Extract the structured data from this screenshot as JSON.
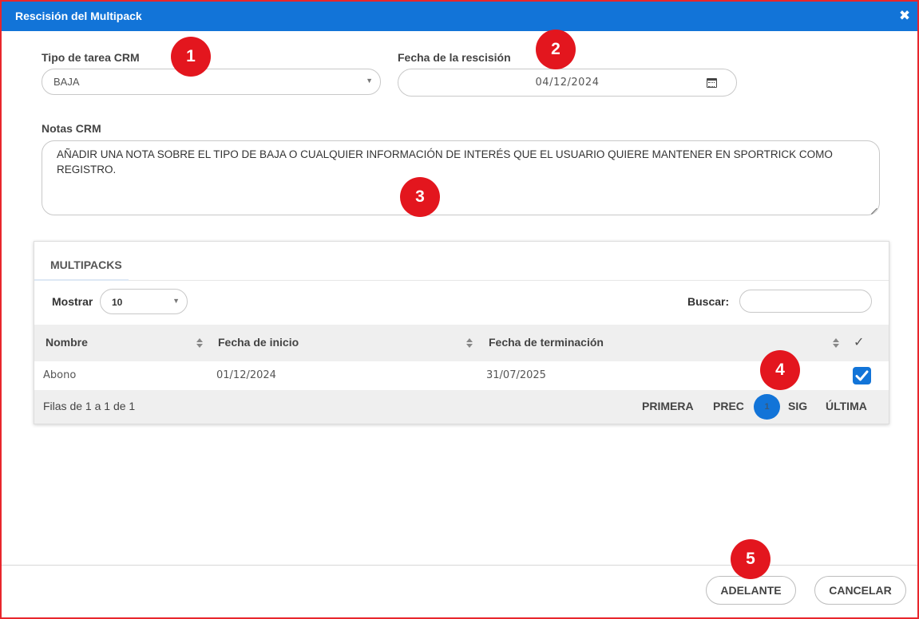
{
  "dialog": {
    "title": "Rescisión del Multipack",
    "close_glyph": "✖"
  },
  "form": {
    "task_type_label": "Tipo de tarea CRM",
    "task_type_value": "BAJA",
    "date_label": "Fecha de la rescisión",
    "date_value": "04/12/2024",
    "notes_label": "Notas CRM",
    "notes_value": "AÑADIR UNA NOTA SOBRE EL TIPO DE BAJA O CUALQUIER INFORMACIÓN DE INTERÉS QUE EL USUARIO QUIERE MANTENER EN SPORTRICK COMO REGISTRO."
  },
  "table": {
    "tab_label": "MULTIPACKS",
    "show_label": "Mostrar",
    "show_value": "10",
    "search_label": "Buscar:",
    "search_value": "",
    "columns": [
      "Nombre",
      "Fecha de inicio",
      "Fecha de terminación",
      "✓"
    ],
    "rows": [
      {
        "name": "Abono",
        "start": "01/12/2024",
        "end": "31/07/2025",
        "checked": true
      }
    ],
    "rows_info": "Filas de 1 a 1 de 1",
    "pager": {
      "first": "PRIMERA",
      "prev": "PREC",
      "current": "1",
      "next": "SIG",
      "last": "ÚLTIMA"
    }
  },
  "buttons": {
    "next": "ADELANTE",
    "cancel": "CANCELAR"
  },
  "badges": [
    "1",
    "2",
    "3",
    "4",
    "5"
  ],
  "colors": {
    "accent": "#1274d8",
    "badge": "#e3161e",
    "frame_border": "#e8262c"
  },
  "icons": {
    "close": "close-icon",
    "calendar": "calendar-icon",
    "dropdown": "chevron-down-icon",
    "sort": "sort-icon",
    "check": "check-icon"
  }
}
